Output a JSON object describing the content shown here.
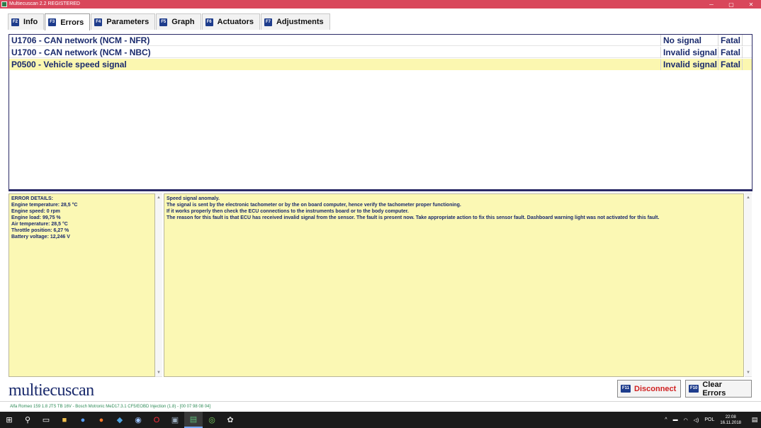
{
  "window": {
    "title": "Multiecuscan 2.2 REGISTERED",
    "minimize": "─",
    "restore": "▢",
    "close": "✕"
  },
  "tabs": [
    {
      "key": "F2",
      "label": "Info"
    },
    {
      "key": "F3",
      "label": "Errors"
    },
    {
      "key": "F4",
      "label": "Parameters"
    },
    {
      "key": "F5",
      "label": "Graph"
    },
    {
      "key": "F6",
      "label": "Actuators"
    },
    {
      "key": "F7",
      "label": "Adjustments"
    }
  ],
  "active_tab": "Errors",
  "errors": [
    {
      "code": "U1706 - CAN network (NCM - NFR)",
      "status": "No signal",
      "severity": "Fatal"
    },
    {
      "code": "U1700 - CAN network (NCM - NBC)",
      "status": "Invalid signal",
      "severity": "Fatal"
    },
    {
      "code": "P0500 - Vehicle speed signal",
      "status": "Invalid signal",
      "severity": "Fatal"
    }
  ],
  "error_details": {
    "heading": "ERROR DETAILS:",
    "lines": [
      "Engine temperature: 28,5 °C",
      "Engine speed: 0 rpm",
      "Engine load: 99,75 %",
      "Air temperature: 28,5 °C",
      "Throttle position: 6,27 %",
      "Battery voltage: 12,246 V"
    ]
  },
  "description": {
    "lines": [
      "Speed signal anomaly.",
      "The signal is sent by the electronic tachometer or by the on board computer, hence verify the tachometer proper functioning.",
      "If it works properly then check the ECU connections to the instruments board or to the body computer.",
      "The reason for this fault is that ECU has received invalid signal from the sensor. The fault is present now. Take appropriate action to fix this sensor fault. Dashboard warning light was not activated for this fault."
    ]
  },
  "brand": "multiecuscan",
  "buttons": {
    "disconnect": {
      "key": "F11",
      "label": "Disconnect"
    },
    "clear_errors": {
      "key": "F10",
      "label": "Clear Errors"
    }
  },
  "status_bar": "Alfa Romeo 159 1.8 JTS TB 16V - Bosch Motronic MeD17.3.1 CF5/EOBD Injection (1.8) - [00 07 98 08 04]",
  "taskbar": {
    "icons": [
      "start-icon",
      "search-icon",
      "task-view-icon",
      "file-explorer-icon",
      "browser-icon",
      "firefox-icon",
      "app-icon",
      "steam-icon",
      "opera-icon",
      "app2-icon",
      "multiecuscan-icon",
      "chrome-icon",
      "app3-icon"
    ],
    "tray_lang": "POL",
    "time": "22:08",
    "date": "16.11.2018"
  },
  "colors": {
    "titlebar": "#d9475b",
    "accent_navy": "#1a2a6c",
    "highlight_yellow": "#fbf7b0",
    "detail_yellow": "#fbf8b4",
    "disconnect_red": "#d02020"
  }
}
